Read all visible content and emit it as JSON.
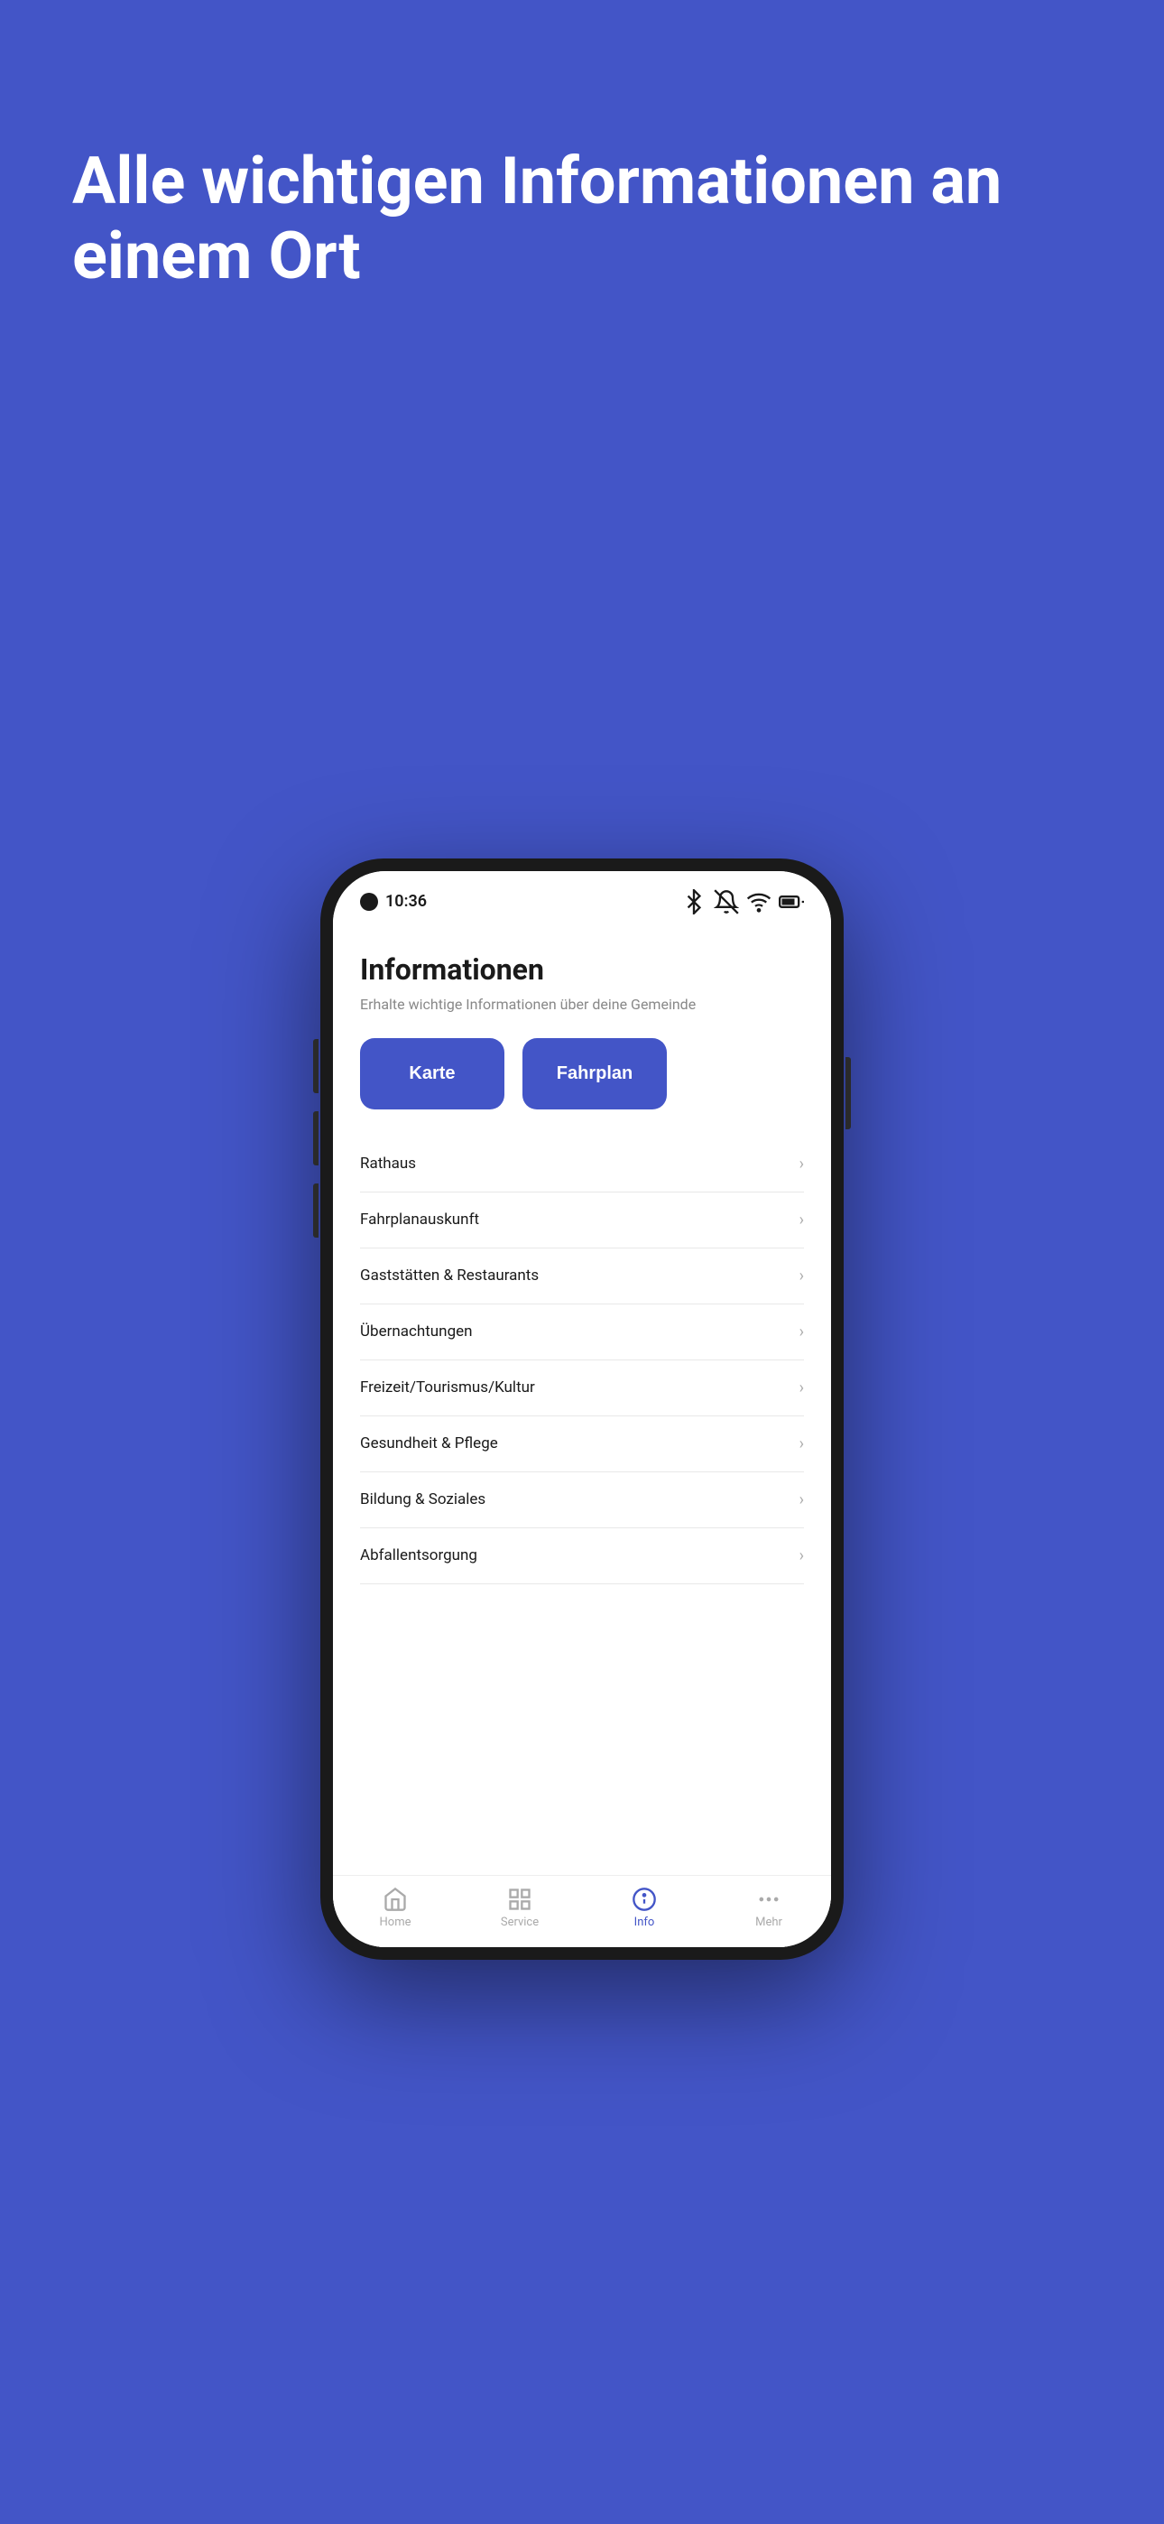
{
  "background_color": "#4355C7",
  "hero": {
    "title": "Alle wichtigen Informationen an einem Ort"
  },
  "phone": {
    "status_bar": {
      "time": "10:36"
    },
    "app": {
      "title": "Informationen",
      "subtitle": "Erhalte wichtige Informationen über deine Gemeinde",
      "quick_buttons": [
        {
          "label": "Karte"
        },
        {
          "label": "Fahrplan"
        }
      ],
      "menu_items": [
        {
          "label": "Rathaus"
        },
        {
          "label": "Fahrplanauskunft"
        },
        {
          "label": "Gaststätten & Restaurants"
        },
        {
          "label": "Übernachtungen"
        },
        {
          "label": "Freizeit/Tourismus/Kultur"
        },
        {
          "label": "Gesundheit & Pflege"
        },
        {
          "label": "Bildung & Soziales"
        },
        {
          "label": "Abfallentsorgung"
        }
      ]
    },
    "bottom_nav": [
      {
        "label": "Home",
        "icon": "home",
        "active": false
      },
      {
        "label": "Service",
        "icon": "grid",
        "active": false
      },
      {
        "label": "Info",
        "icon": "info-circle",
        "active": true
      },
      {
        "label": "Mehr",
        "icon": "more",
        "active": false
      }
    ]
  }
}
